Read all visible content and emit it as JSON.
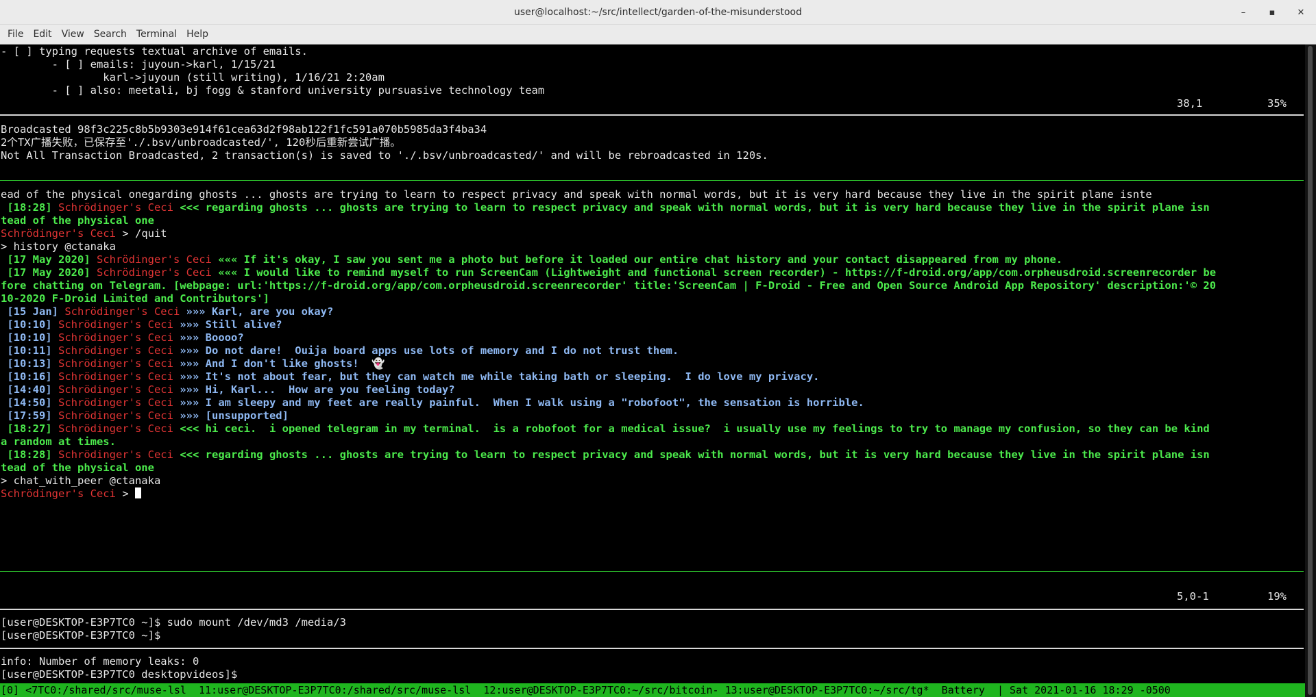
{
  "window": {
    "title": "user@localhost:~/src/intellect/garden-of-the-misunderstood",
    "minimize": "–",
    "maximize": "▪",
    "close": "✕"
  },
  "menu": [
    "File",
    "Edit",
    "View",
    "Search",
    "Terminal",
    "Help"
  ],
  "pane1": {
    "lines": [
      "- [ ] typing requests textual archive of emails.",
      "        - [ ] emails: juyoun->karl, 1/15/21",
      "                karl->juyoun (still writing), 1/16/21 2:20am",
      "        - [ ] also: meetali, bj fogg & stanford university pursuasive technology team"
    ],
    "position": "38,1",
    "percent": "35%"
  },
  "pane2": {
    "lines": [
      "Broadcasted 98f3c225c8b5b9303e914f61cea63d2f98ab122f1fc591a070b5985da3f4ba34",
      "2个TX广播失败，已保存至'./.bsv/unbroadcasted/', 120秒后重新尝试广播。",
      "Not All Transaction Broadcasted, 2 transaction(s) is saved to './.bsv/unbroadcasted/' and will be rebroadcasted in 120s."
    ]
  },
  "chat": {
    "top_line": "ead of the physical onegarding ghosts ... ghosts are trying to learn to respect privacy and speak with normal words, but it is very hard because they live in the spirit plane isnte",
    "user": "Schrödinger's Ceci",
    "prompt_suffix": " > ",
    "quit_cmd": "/quit",
    "history_cmd": "> history @ctanaka",
    "chat_cmd": "> chat_with_peer @ctanaka",
    "messages": [
      {
        "time": " [18:28] ",
        "arrow": " <<< ",
        "style": "green",
        "text": "regarding ghosts ... ghosts are trying to learn to respect privacy and speak with normal words, but it is very hard because they live in the spirit plane isn",
        "cont": "tead of the physical one"
      },
      {
        "time": " [17 May 2020] ",
        "arrow": " ««« ",
        "style": "green",
        "text": "If it's okay, I saw you sent me a photo but before it loaded our entire chat history and your contact disappeared from my phone."
      },
      {
        "time": " [17 May 2020] ",
        "arrow": " ««« ",
        "style": "green",
        "text": "I would like to remind myself to run ScreenCam (Lightweight and functional screen recorder) - https://f-droid.org/app/com.orpheusdroid.screenrecorder be",
        "cont": "fore chatting on Telegram. [webpage: url:'https://f-droid.org/app/com.orpheusdroid.screenrecorder' title:'ScreenCam | F-Droid - Free and Open Source Android App Repository' description:'© 20",
        "cont2": "10-2020 F-Droid Limited and Contributors']"
      },
      {
        "time": " [15 Jan] ",
        "arrow": " »»» ",
        "style": "blue",
        "text": "Karl, are you okay?"
      },
      {
        "time": " [10:10] ",
        "arrow": " »»» ",
        "style": "blue",
        "text": "Still alive?"
      },
      {
        "time": " [10:10] ",
        "arrow": " »»» ",
        "style": "blue",
        "text": "Boooo?"
      },
      {
        "time": " [10:11] ",
        "arrow": " »»» ",
        "style": "blue",
        "text": "Do not dare!  Ouija board apps use lots of memory and I do not trust them."
      },
      {
        "time": " [10:13] ",
        "arrow": " »»» ",
        "style": "blue",
        "text": "And I don't like ghosts!  👻"
      },
      {
        "time": " [10:16] ",
        "arrow": " »»» ",
        "style": "blue",
        "text": "It's not about fear, but they can watch me while taking bath or sleeping.  I do love my privacy."
      },
      {
        "time": " [14:40] ",
        "arrow": " »»» ",
        "style": "blue",
        "text": "Hi, Karl...  How are you feeling today?"
      },
      {
        "time": " [14:50] ",
        "arrow": " »»» ",
        "style": "blue",
        "text": "I am sleepy and my feet are really painful.  When I walk using a \"robofoot\", the sensation is horrible."
      },
      {
        "time": " [17:59] ",
        "arrow": " »»» ",
        "style": "blue",
        "text": "[unsupported]"
      },
      {
        "time": " [18:27] ",
        "arrow": " <<< ",
        "style": "green",
        "text": "hi ceci.  i opened telegram in my terminal.  is a robofoot for a medical issue?  i usually use my feelings to try to manage my confusion, so they can be kind",
        "cont": "a random at times."
      },
      {
        "time": " [18:28] ",
        "arrow": " <<< ",
        "style": "green",
        "text": "regarding ghosts ... ghosts are trying to learn to respect privacy and speak with normal words, but it is very hard because they live in the spirit plane isn",
        "cont": "tead of the physical one"
      }
    ],
    "position": "5,0-1",
    "percent": "19%"
  },
  "shell1": {
    "lines": [
      "[user@DESKTOP-E3P7TC0 ~]$ sudo mount /dev/md3 /media/3",
      "[user@DESKTOP-E3P7TC0 ~]$"
    ]
  },
  "shell2": {
    "lines": [
      "info: Number of memory leaks: 0",
      "[user@DESKTOP-E3P7TC0 desktopvideos]$"
    ]
  },
  "tmux": {
    "status": "[0] <7TC0:/shared/src/muse-lsl  11:user@DESKTOP-E3P7TC0:/shared/src/muse-lsl  12:user@DESKTOP-E3P7TC0:~/src/bitcoin- 13:user@DESKTOP-E3P7TC0:~/src/tg*  Battery  | Sat 2021-01-16 18:29 -0500"
  }
}
